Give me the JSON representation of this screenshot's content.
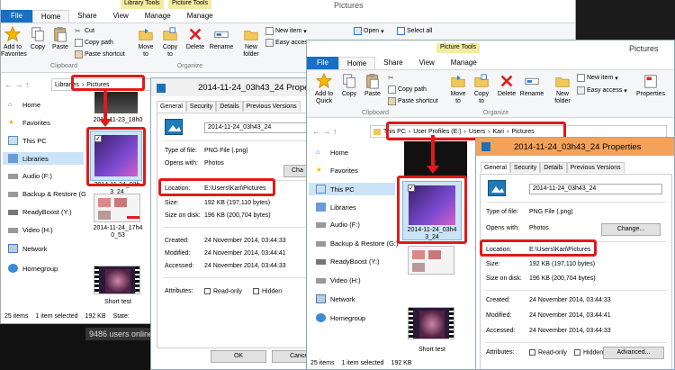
{
  "back_window": {
    "title": "Pictures",
    "context_tabs": {
      "library_tools": "Library Tools",
      "picture_tools": "Picture Tools"
    },
    "tabs": [
      "File",
      "Home",
      "Share",
      "View",
      "Manage",
      "Manage"
    ],
    "ribbon": {
      "add_to_favorites": "Add to Favorites",
      "copy": "Copy",
      "paste": "Paste",
      "cut": "Cut",
      "copy_path": "Copy path",
      "paste_shortcut": "Paste shortcut",
      "move_to": "Move to",
      "copy_to": "Copy to",
      "delete": "Delete",
      "rename": "Rename",
      "new_folder": "New folder",
      "new_item": "New item",
      "easy_access": "Easy access",
      "open": "Open",
      "select_all": "Select all",
      "clipboard": "Clipboard",
      "organize": "Organize"
    },
    "breadcrumb": [
      "Libraries",
      "Pictures"
    ],
    "nav": [
      "Home",
      "Favorites",
      "This PC",
      "Libraries",
      "Audio (F:)",
      "Backup & Restore (G",
      "ReadyBoost (Y:)",
      "Video (H:)",
      "Network",
      "Homegroup"
    ],
    "files": [
      {
        "name": "2014-11-23_18h0"
      },
      {
        "name": "2014-11-24_03h\n3_24"
      },
      {
        "name": "2014-11-24_17h4\n0_53"
      },
      {
        "name": "Short test"
      }
    ],
    "status": {
      "items": "25 items",
      "selected": "1 item selected",
      "size": "192 KB",
      "state": "State:"
    }
  },
  "back_dialog": {
    "title": "2014-11-24_03h43_24 Properties",
    "tabs": [
      "General",
      "Security",
      "Details",
      "Previous Versions"
    ],
    "filename": "2014-11-24_03h43_24",
    "rows": [
      {
        "label": "Type of file:",
        "value": "PNG File (.png)"
      },
      {
        "label": "Opens with:",
        "value": "Photos"
      },
      {
        "label": "Location:",
        "value": "E:\\Users\\Kari\\Pictures"
      },
      {
        "label": "Size:",
        "value": "192 KB (197,110 bytes)"
      },
      {
        "label": "Size on disk:",
        "value": "196 KB (200,704 bytes)"
      },
      {
        "label": "Created:",
        "value": "24 November 2014, 03:44:33"
      },
      {
        "label": "Modified:",
        "value": "24 November 2014, 03:44:41"
      },
      {
        "label": "Accessed:",
        "value": "24 November 2014, 03:44:33"
      }
    ],
    "change_partial": "Cha",
    "attributes_label": "Attributes:",
    "readonly": "Read-only",
    "hidden": "Hidden",
    "ok": "OK",
    "cancel": "Cancel"
  },
  "front_window": {
    "title": "Pictures",
    "context_tab": "Picture Tools",
    "tabs": [
      "File",
      "Home",
      "Share",
      "View",
      "Manage"
    ],
    "ribbon": {
      "add_to_quick": "Add to Quick",
      "copy": "Copy",
      "paste": "Paste",
      "copy_path": "Copy path",
      "paste_shortcut": "Paste shortcut",
      "move_to": "Move to",
      "copy_to": "Copy to",
      "delete": "Delete",
      "rename": "Rename",
      "new_folder": "New folder",
      "new_item": "New item",
      "easy_access": "Easy access",
      "properties": "Properties",
      "clipboard": "Clipboard",
      "organize": "Organize"
    },
    "breadcrumb": [
      "This PC",
      "User Profiles (E:)",
      "Users",
      "Kari",
      "Pictures"
    ],
    "nav": [
      "Home",
      "Favorites",
      "This PC",
      "Libraries",
      "Audio (F:)",
      "Backup & Restore (G:)",
      "ReadyBoost (Y:)",
      "Video (H:)",
      "Network",
      "Homegroup"
    ],
    "files": [
      {
        "name": "2014-11-24_03h4\n3_24"
      },
      {
        "name": "Short test"
      }
    ],
    "status": {
      "items": "25 items",
      "selected": "1 item selected",
      "size": "192 KB"
    }
  },
  "front_dialog": {
    "title": "2014-11-24_03h43_24 Properties",
    "tabs": [
      "General",
      "Security",
      "Details",
      "Previous Versions"
    ],
    "filename": "2014-11-24_03h43_24",
    "rows": [
      {
        "label": "Type of file:",
        "value": "PNG File (.png)"
      },
      {
        "label": "Opens with:",
        "value": "Photos"
      },
      {
        "label": "Location:",
        "value": "E:\\Users\\Kari\\Pictures"
      },
      {
        "label": "Size:",
        "value": "192 KB (197,110 bytes)"
      },
      {
        "label": "Size on disk:",
        "value": "196 KB (200,704 bytes)"
      },
      {
        "label": "Created:",
        "value": "24 November 2014, 03:44:33"
      },
      {
        "label": "Modified:",
        "value": "24 November 2014, 03:44:41"
      },
      {
        "label": "Accessed:",
        "value": "24 November 2014, 03:44:33"
      }
    ],
    "change": "Change...",
    "attributes_label": "Attributes:",
    "readonly": "Read-only",
    "hidden": "Hidden",
    "advanced": "Advanced..."
  },
  "taskbar_text": "9486 users online",
  "colors": {
    "accent": "#1a6fc4",
    "dialog_title": "#f4a25a",
    "highlight_red": "#e01a1a",
    "selection": "#cce4f7"
  }
}
